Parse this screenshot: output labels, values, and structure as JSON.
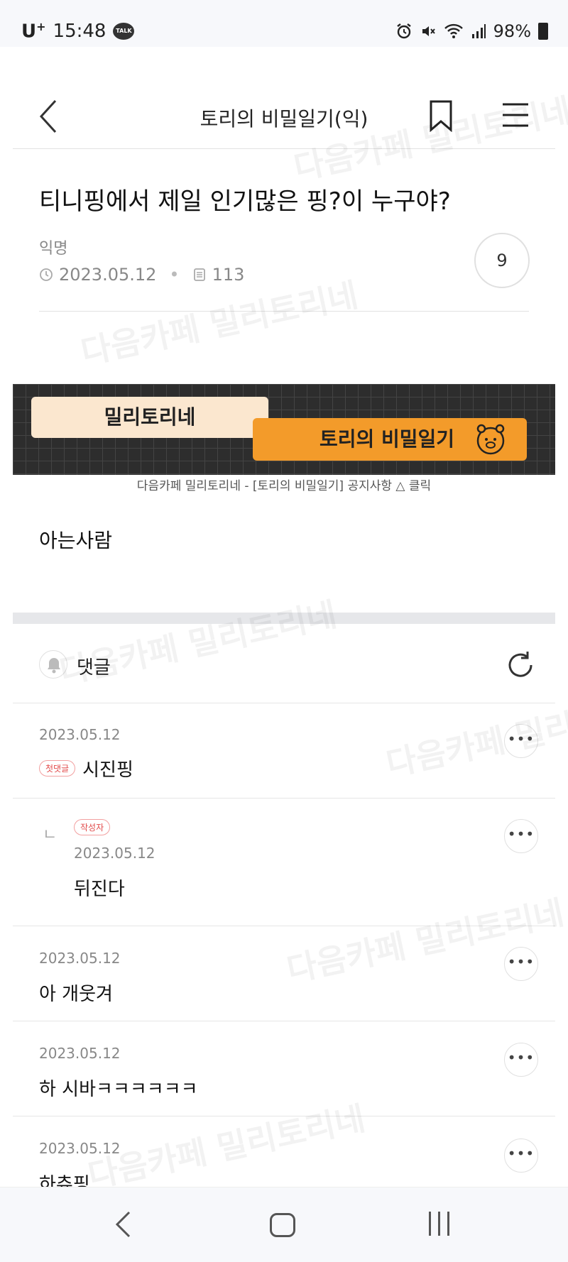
{
  "status_bar": {
    "carrier": "U",
    "carrier_sup": "+",
    "time": "15:48",
    "talk_icon_label": "TALK",
    "battery_percent": "98%"
  },
  "app_bar": {
    "title": "토리의 비밀일기(익)"
  },
  "post": {
    "title": "티니핑에서 제일 인기많은 핑?이 누구야?",
    "author": "익명",
    "date": "2023.05.12",
    "views": "113",
    "comment_count": "9",
    "body": "아는사람"
  },
  "banner": {
    "tag1": "밀리토리네",
    "tag2": "토리의 비밀일기",
    "caption": "다음카페 밀리토리네 - [토리의 비밀일기] 공지사항 △ 클릭"
  },
  "comments_section": {
    "title": "댓글",
    "items": [
      {
        "date": "2023.05.12",
        "badge": "첫댓글",
        "text": "시진핑"
      },
      {
        "date": "2023.05.12",
        "badge": "작성자",
        "reply_mark": "ㄴ",
        "text": "뒤진다"
      },
      {
        "date": "2023.05.12",
        "text": "아 개웃겨"
      },
      {
        "date": "2023.05.12",
        "text": "하 시바ㅋㅋㅋㅋㅋㅋ"
      },
      {
        "date": "2023.05.12",
        "text": "하츄핑"
      }
    ]
  },
  "watermark": "다음카페 밀리토리네"
}
